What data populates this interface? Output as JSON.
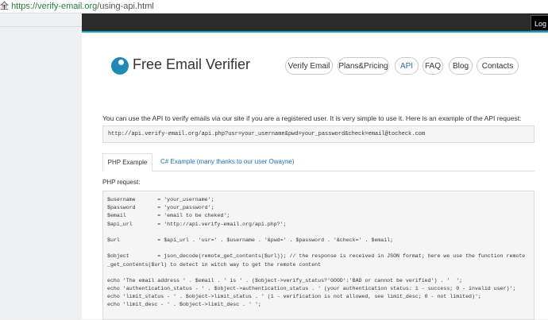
{
  "browser": {
    "url_prefix": "全",
    "url_host": "https://verify-email.org",
    "url_path": "/using-api.html"
  },
  "topbar": {
    "login_label": "Log in"
  },
  "header": {
    "brand": "Free Email Verifier",
    "nav": [
      "Verify Email",
      "Plans&Pricing",
      "API",
      "FAQ",
      "Blog",
      "Contacts"
    ],
    "active": "API"
  },
  "main": {
    "intro": "You can use the API to verify emails via our site if you are a registered user. It is very simple to use it. Here is an example of the API request:",
    "request_url": "http://api.verify-email.org/api.php?usr=your_username&pwd=your_password&check=email@tocheck.com",
    "tabs": [
      "PHP Example",
      "C# Example (many thanks to our user Owayne)"
    ],
    "php_request_label": "PHP request:",
    "code_lines": [
      "$username       = 'your_username';",
      "$password       = 'your_password';",
      "$email          = 'email to be cheked';",
      "$api_url        = 'http://api.verify-email.org/api.php?';",
      "",
      "$url            = $api_url . 'usr=' . $username . '&pwd=' . $password . '&check=' . $email;",
      "",
      "$object         = json_decode(remote_get_contents($url)); // the response is received in JSON format; here we use the function remote",
      "_get_contents($url) to detect in witch way to get the remote content",
      "",
      "echo 'The email address ' . $email . ' is ' . ($object->verify_status?'GOOD':'BAD or cannot be verified') . '  ';",
      "echo 'authentication_status - ' . $object->authentication_status . ' (your authentication status: 1 - success; 0 - invalid user)';",
      "echo 'limit_status - ' . $object->limit_status . ' (1 - verification is not allowed, see limit_desc; 0 - not limited)';",
      "echo 'limit_desc - ' . $object->limit_desc . ' ';"
    ]
  },
  "colors": {
    "accent": "#18a0c3",
    "logo": "#1f8ab3",
    "link": "#1f6fa8",
    "topbar": "#2b2b2b"
  }
}
